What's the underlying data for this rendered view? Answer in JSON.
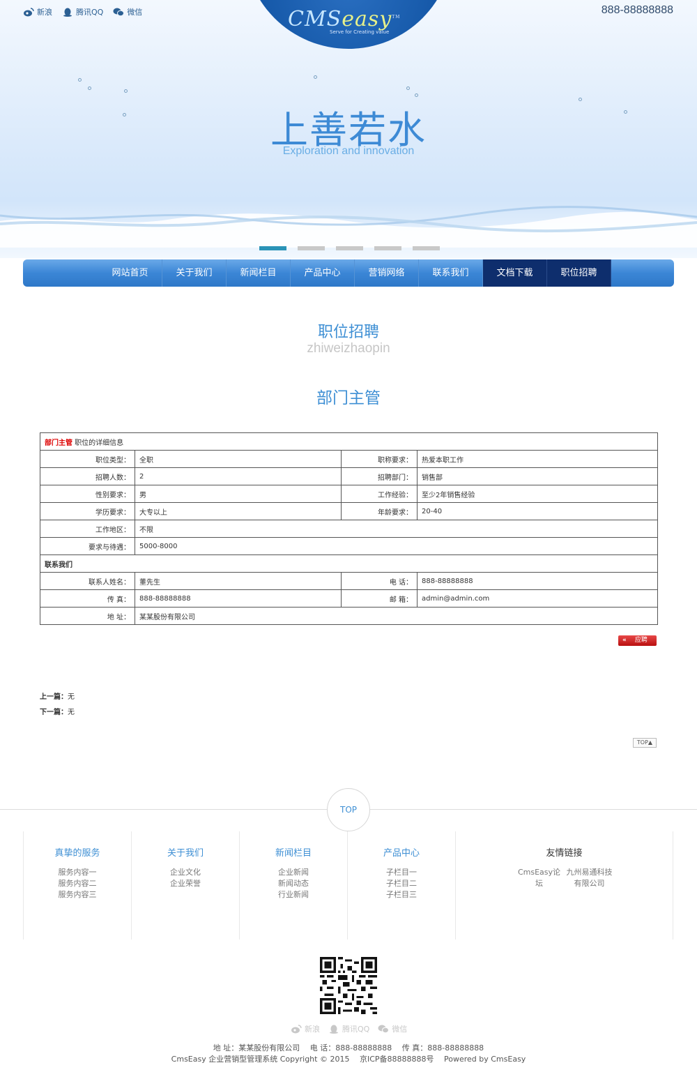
{
  "header": {
    "social": [
      {
        "icon": "weibo-icon",
        "label": "新浪"
      },
      {
        "icon": "qq-icon",
        "label": "腾讯QQ"
      },
      {
        "icon": "wechat-icon",
        "label": "微信"
      }
    ],
    "logo_main": "CMS",
    "logo_easy": "easy",
    "logo_tm": "TM",
    "logo_tagline": "Serve for Creating value",
    "phone": "888-88888888"
  },
  "banner": {
    "slogan": "上善若水",
    "slogan_sub": "Exploration and innovation",
    "active_slide": 1,
    "slide_count": 5
  },
  "nav": {
    "items": [
      "网站首页",
      "关于我们",
      "新闻栏目",
      "产品中心",
      "营销网络",
      "联系我们",
      "文档下载",
      "职位招聘"
    ],
    "active": [
      "文档下载",
      "职位招聘"
    ]
  },
  "page": {
    "section_title": "职位招聘",
    "section_pinyin": "zhiweizhaopin",
    "job_title": "部门主管"
  },
  "detail": {
    "head_red": "部门主管",
    "head_rest": "职位的详细信息",
    "rows": [
      {
        "l1": "职位类型：",
        "v1": "全职",
        "l2": "职称要求：",
        "v2": "热爱本职工作"
      },
      {
        "l1": "招聘人数：",
        "v1": "2",
        "l2": "招聘部门：",
        "v2": "销售部"
      },
      {
        "l1": "性别要求：",
        "v1": "男",
        "l2": "工作经验：",
        "v2": "至少2年销售经验"
      },
      {
        "l1": "学历要求：",
        "v1": "大专以上",
        "l2": "年龄要求：",
        "v2": "20-40"
      }
    ],
    "area_label": "工作地区：",
    "area_value": "不限",
    "salary_label": "要求与待遇：",
    "salary_value": "5000-8000",
    "contact_heading": "联系我们",
    "contact_rows": [
      {
        "l1": "联系人姓名：",
        "v1": "董先生",
        "l2": "电 话：",
        "v2": "888-88888888"
      },
      {
        "l1": "传 真：",
        "v1": "888-88888888",
        "l2": "邮 箱：",
        "v2": "admin@admin.com"
      }
    ],
    "address_label": "地 址：",
    "address_value": "某某股份有限公司"
  },
  "apply": {
    "arrow": "«",
    "label": "应聘"
  },
  "prevnext": {
    "prev_label": "上一篇：",
    "prev_value": "无",
    "next_label": "下一篇：",
    "next_value": "无"
  },
  "top_small": "TOP▲",
  "footer": {
    "top_label": "TOP",
    "columns": [
      {
        "title": "真挚的服务",
        "items": [
          "服务内容一",
          "服务内容二",
          "服务内容三"
        ]
      },
      {
        "title": "关于我们",
        "items": [
          "企业文化",
          "企业荣誉"
        ]
      },
      {
        "title": "新闻栏目",
        "items": [
          "企业新闻",
          "新闻动态",
          "行业新闻"
        ]
      },
      {
        "title": "产品中心",
        "items": [
          "子栏目一",
          "子栏目二",
          "子栏目三"
        ]
      }
    ],
    "links_title": "友情链接",
    "links": [
      {
        "line1": "CmsEasy论",
        "line2": "坛"
      },
      {
        "line1": "九州易通科技",
        "line2": "有限公司"
      }
    ],
    "social": [
      {
        "icon": "weibo-icon",
        "label": "新浪"
      },
      {
        "icon": "qq-icon",
        "label": "腾讯QQ"
      },
      {
        "icon": "wechat-icon",
        "label": "微信"
      }
    ],
    "info_line1": "地 址：某某股份有限公司　 电 话：888-88888888　 传 真：888-88888888",
    "info_line2": "CmsEasy 企业营销型管理系统 Copyright © 2015　 京ICP备88888888号　 Powered by CmsEasy"
  }
}
